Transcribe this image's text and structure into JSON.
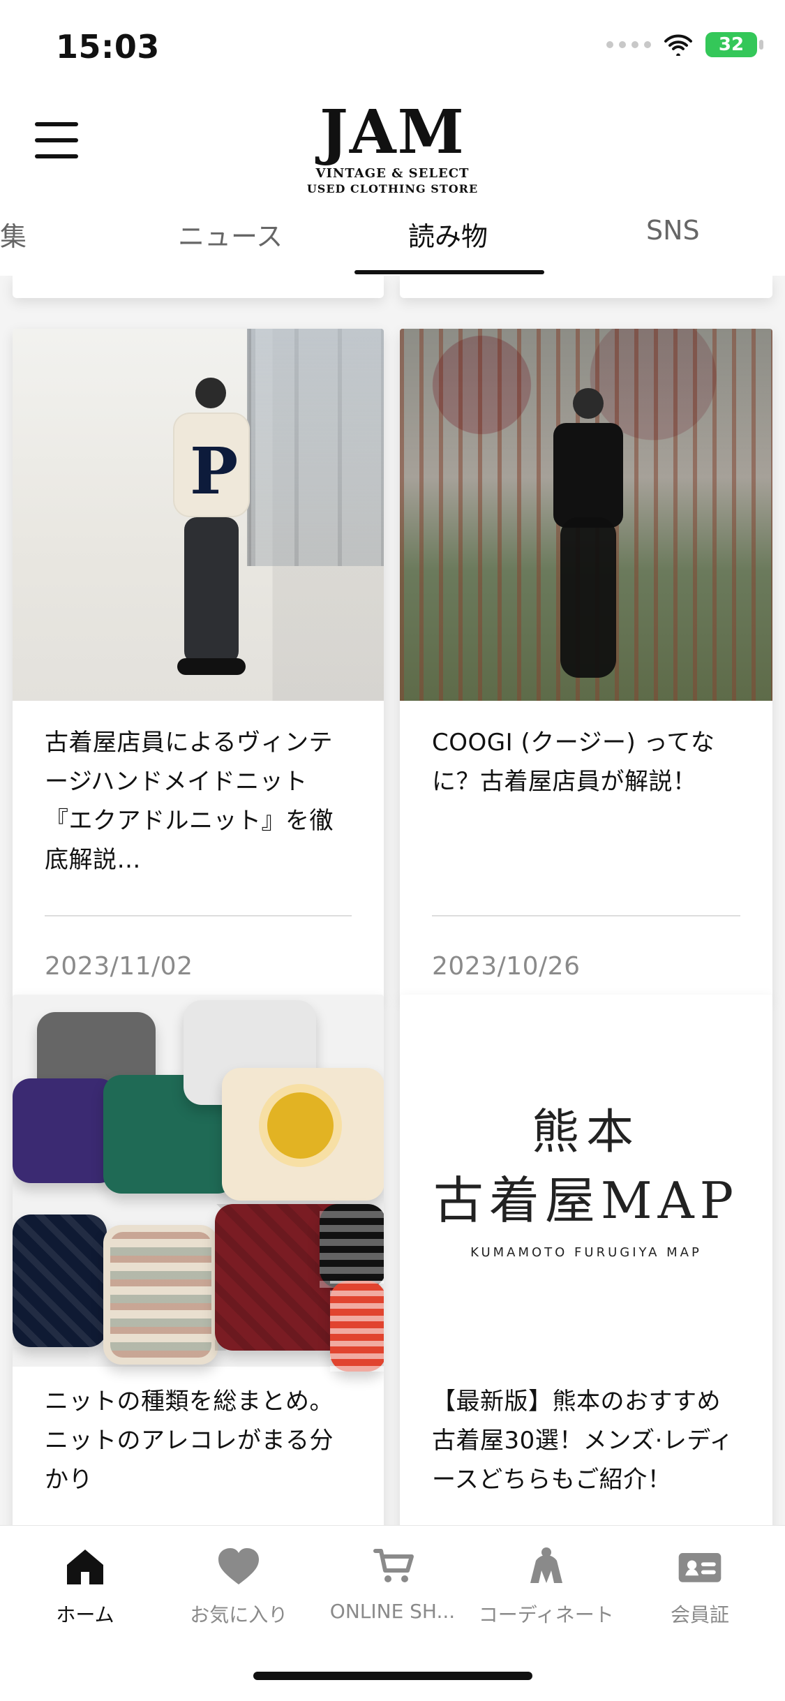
{
  "status_bar": {
    "time": "15:03",
    "battery": "32"
  },
  "header": {
    "logo_main": "JAM",
    "logo_tag_1": "VINTAGE & SELECT",
    "logo_tag_2": "USED CLOTHING STORE"
  },
  "tabs": [
    {
      "label": "集"
    },
    {
      "label": "ニュース"
    },
    {
      "label": "読み物",
      "active": true
    },
    {
      "label": "SNS"
    }
  ],
  "articles": [
    {
      "title": "古着屋店員によるヴィンテージハンドメイドニット『エクアドルニット』を徹底解説…",
      "date": "2023/11/02"
    },
    {
      "title": "COOGI (クージー) ってなに？古着屋店員が解説！",
      "date": "2023/10/26"
    },
    {
      "title": "ニットの種類を総まとめ。ニットのアレコレがまる分かり",
      "date": ""
    },
    {
      "title": "【最新版】熊本のおすすめ古着屋30選！メンズ·レディースどちらもご紹介！",
      "date": "",
      "image_text": {
        "line1": "熊本",
        "line2": "古着屋MAP",
        "subtitle": "KUMAMOTO FURUGIYA MAP"
      }
    }
  ],
  "bottom_nav": [
    {
      "label": "ホーム",
      "icon": "home-icon",
      "active": true
    },
    {
      "label": "お気に入り",
      "icon": "heart-icon"
    },
    {
      "label": "ONLINE SH...",
      "icon": "cart-icon"
    },
    {
      "label": "コーディネート",
      "icon": "person-outfit-icon"
    },
    {
      "label": "会員証",
      "icon": "member-card-icon"
    }
  ],
  "colors": {
    "background": "#f4f4f4",
    "active_text": "#111111",
    "inactive_text": "#8a8a8a",
    "battery_green": "#34c759"
  }
}
